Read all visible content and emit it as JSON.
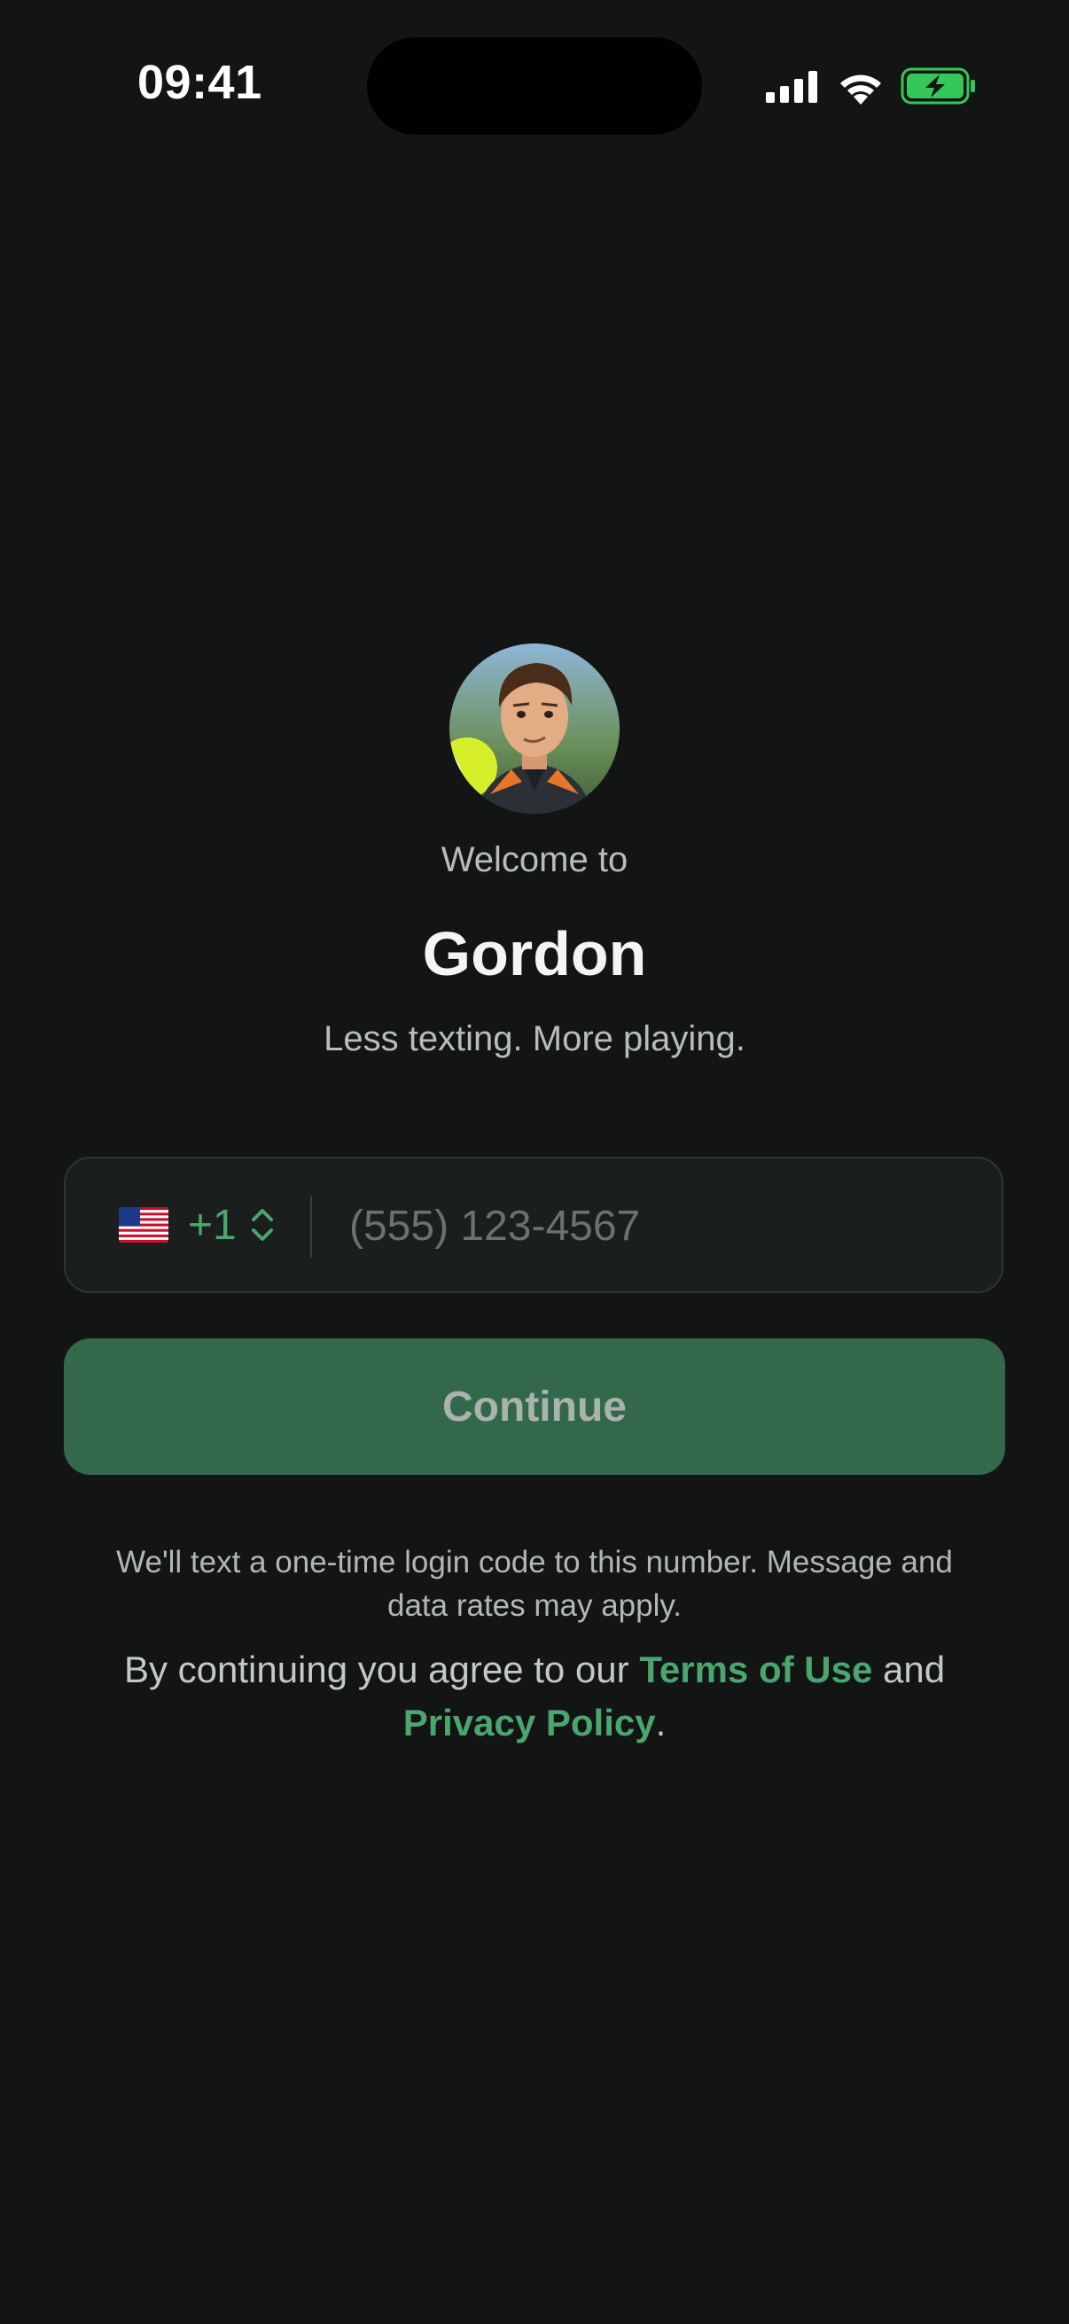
{
  "status_bar": {
    "time": "09:41",
    "icons": [
      "cellular-signal-icon",
      "wifi-icon",
      "battery-charging-icon"
    ]
  },
  "welcome_text": "Welcome to",
  "app_name": "Gordon",
  "tagline": "Less texting. More playing.",
  "phone": {
    "country_flag": "us-flag-icon",
    "dial_code": "+1",
    "placeholder": "(555) 123-4567",
    "value": ""
  },
  "continue_label": "Continue",
  "disclaimer": "We'll text a one-time login code to this number. Message and data rates may apply.",
  "legal": {
    "prefix": "By continuing you agree to our ",
    "terms_label": "Terms of Use",
    "middle": " and ",
    "privacy_label": "Privacy Policy",
    "suffix": "."
  },
  "colors": {
    "background": "#131515",
    "accent": "#4aa66e",
    "button_bg": "#33684b",
    "field_bg": "#1a1e1c",
    "battery": "#34c759"
  }
}
